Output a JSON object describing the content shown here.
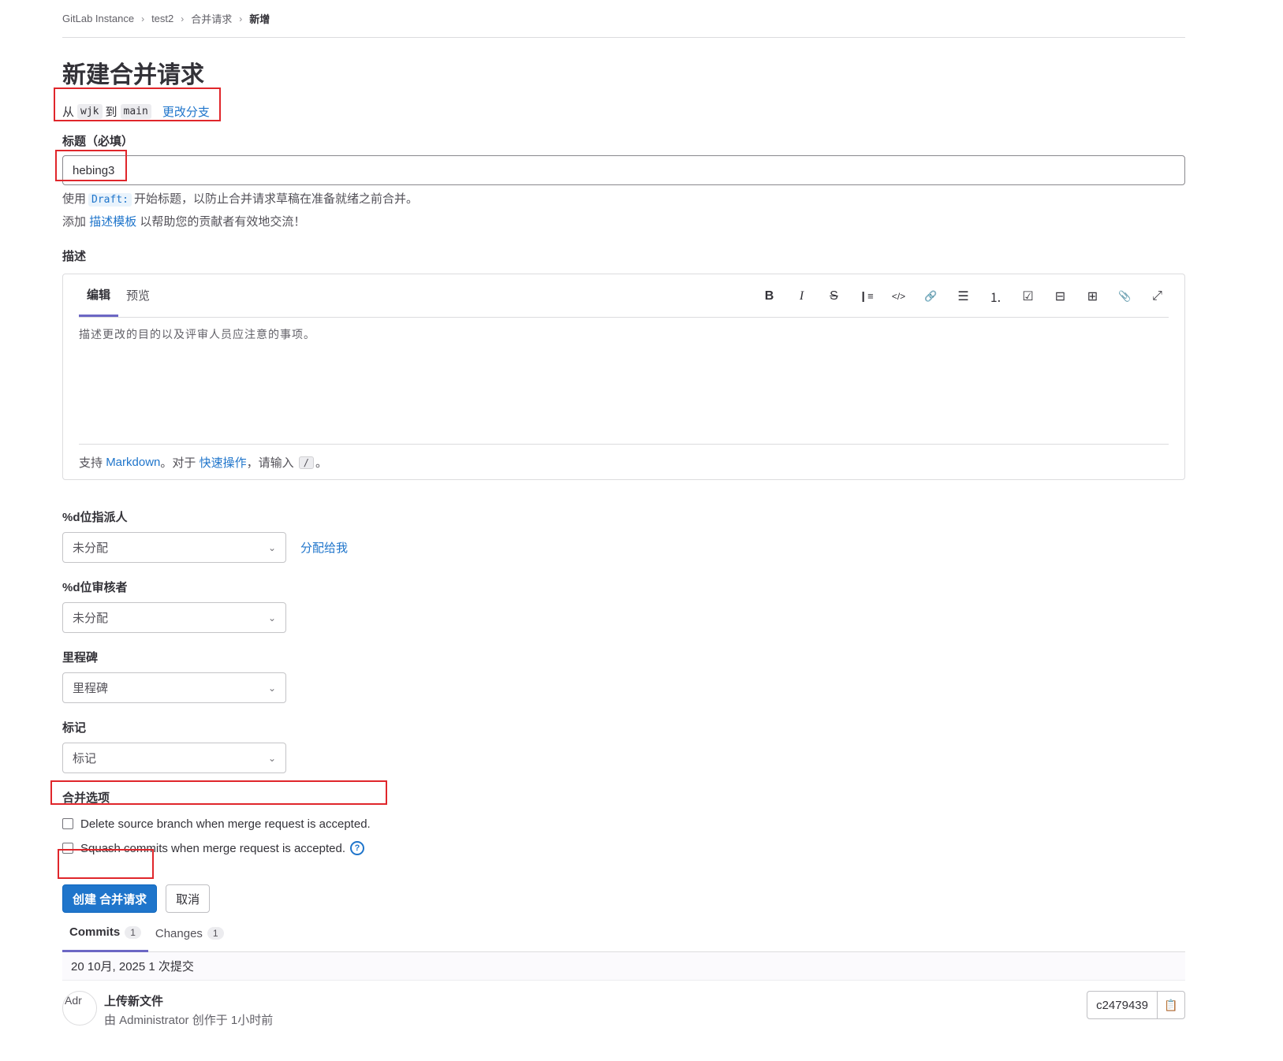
{
  "breadcrumb": [
    "GitLab Instance",
    "test2",
    "合并请求",
    "新增"
  ],
  "page_title": "新建合并请求",
  "branch": {
    "from_prefix": "从",
    "source": "wjk",
    "to_word": "到",
    "target": "main",
    "change_link": "更改分支"
  },
  "title_field": {
    "label": "标题（必填）",
    "value": "hebing3",
    "help_prefix": "使用",
    "help_code": "Draft:",
    "help_suffix": "开始标题，以防止合并请求草稿在准备就绪之前合并。",
    "template_prefix": "添加",
    "template_link": "描述模板",
    "template_suffix": "以帮助您的贡献者有效地交流！"
  },
  "description": {
    "label": "描述",
    "tabs": [
      "编辑",
      "预览"
    ],
    "toolbar": [
      {
        "name": "bold-icon",
        "glyph": "B"
      },
      {
        "name": "italic-icon",
        "glyph": "I"
      },
      {
        "name": "strikethrough-icon",
        "glyph": "S"
      },
      {
        "name": "quote-icon",
        "glyph": "❙≡"
      },
      {
        "name": "code-icon",
        "glyph": "</>"
      },
      {
        "name": "link-icon",
        "glyph": "🔗"
      },
      {
        "name": "bulleted-list-icon",
        "glyph": "☰"
      },
      {
        "name": "numbered-list-icon",
        "glyph": "⒈"
      },
      {
        "name": "task-list-icon",
        "glyph": "☑"
      },
      {
        "name": "collapsible-icon",
        "glyph": "⊟"
      },
      {
        "name": "table-icon",
        "glyph": "⊞"
      },
      {
        "name": "attach-icon",
        "glyph": "📎"
      },
      {
        "name": "fullscreen-icon",
        "glyph": "⤢"
      }
    ],
    "placeholder": "描述更改的目的以及评审人员应注意的事项。",
    "footer_prefix": "支持",
    "footer_markdown": "Markdown",
    "footer_mid": "。对于",
    "footer_quick": "快速操作",
    "footer_type": "，请输入",
    "footer_slash": "/",
    "footer_end": "。"
  },
  "assignee": {
    "label": "%d位指派人",
    "value": "未分配",
    "assign_me": "分配给我"
  },
  "reviewer": {
    "label": "%d位审核者",
    "value": "未分配"
  },
  "milestone": {
    "label": "里程碑",
    "value": "里程碑"
  },
  "labels": {
    "label": "标记",
    "value": "标记"
  },
  "merge_options": {
    "label": "合并选项",
    "delete_source": "Delete source branch when merge request is accepted.",
    "squash": "Squash commits when merge request is accepted.",
    "help_glyph": "?"
  },
  "actions": {
    "create": "创建 合并请求",
    "cancel": "取消"
  },
  "bottom_tabs": [
    {
      "label": "Commits",
      "count": "1"
    },
    {
      "label": "Changes",
      "count": "1"
    }
  ],
  "commits": {
    "day_header": "20 10月, 2025 1 次提交",
    "items": [
      {
        "avatar_alt": "Adr",
        "title": "上传新文件",
        "meta": "由 Administrator 创作于 1小时前",
        "sha": "c2479439",
        "copy_icon": "clipboard-icon"
      }
    ]
  },
  "colors": {
    "accent": "#1f75cb",
    "highlight_box": "#e0262b",
    "tab_underline": "#6c67c4"
  }
}
